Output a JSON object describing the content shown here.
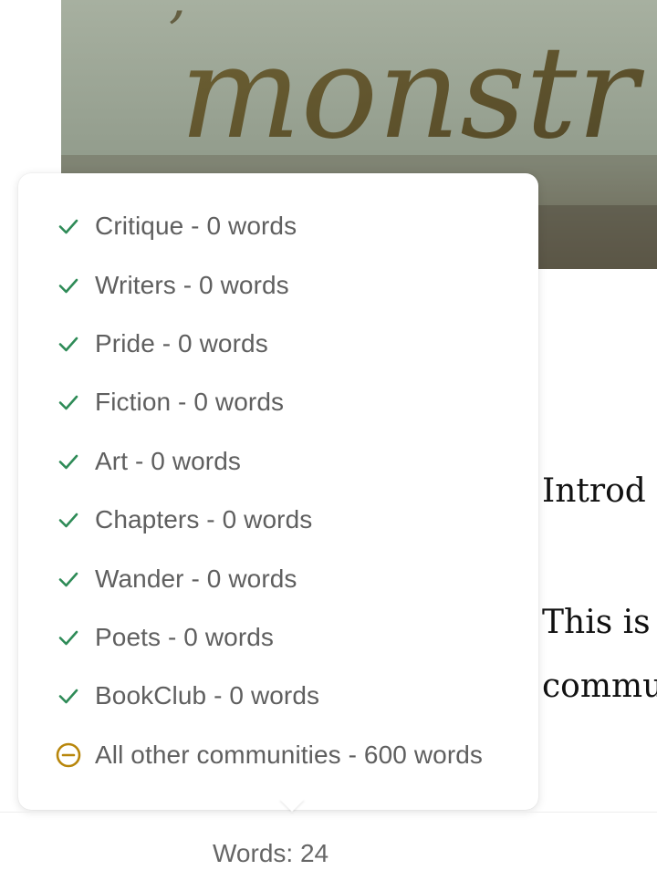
{
  "cover": {
    "image_text": "monstr"
  },
  "article": {
    "line1": "Introd",
    "line2": "This is",
    "line3": "commu"
  },
  "popover": {
    "communities": [
      {
        "label": "Critique - 0 words",
        "status": "included",
        "icon": "check-icon"
      },
      {
        "label": "Writers - 0 words",
        "status": "included",
        "icon": "check-icon"
      },
      {
        "label": "Pride - 0 words",
        "status": "included",
        "icon": "check-icon"
      },
      {
        "label": "Fiction - 0 words",
        "status": "included",
        "icon": "check-icon"
      },
      {
        "label": "Art - 0 words",
        "status": "included",
        "icon": "check-icon"
      },
      {
        "label": "Chapters - 0 words",
        "status": "included",
        "icon": "check-icon"
      },
      {
        "label": "Wander - 0 words",
        "status": "included",
        "icon": "check-icon"
      },
      {
        "label": "Poets - 0 words",
        "status": "included",
        "icon": "check-icon"
      },
      {
        "label": "BookClub - 0 words",
        "status": "included",
        "icon": "check-icon"
      },
      {
        "label": "All other communities - 600 words",
        "status": "excluded",
        "icon": "minus-circle-icon"
      }
    ]
  },
  "footer": {
    "word_count": "Words: 24"
  },
  "colors": {
    "check": "#2e8b57",
    "minus": "#b8860b",
    "label": "#5f5f5f"
  }
}
